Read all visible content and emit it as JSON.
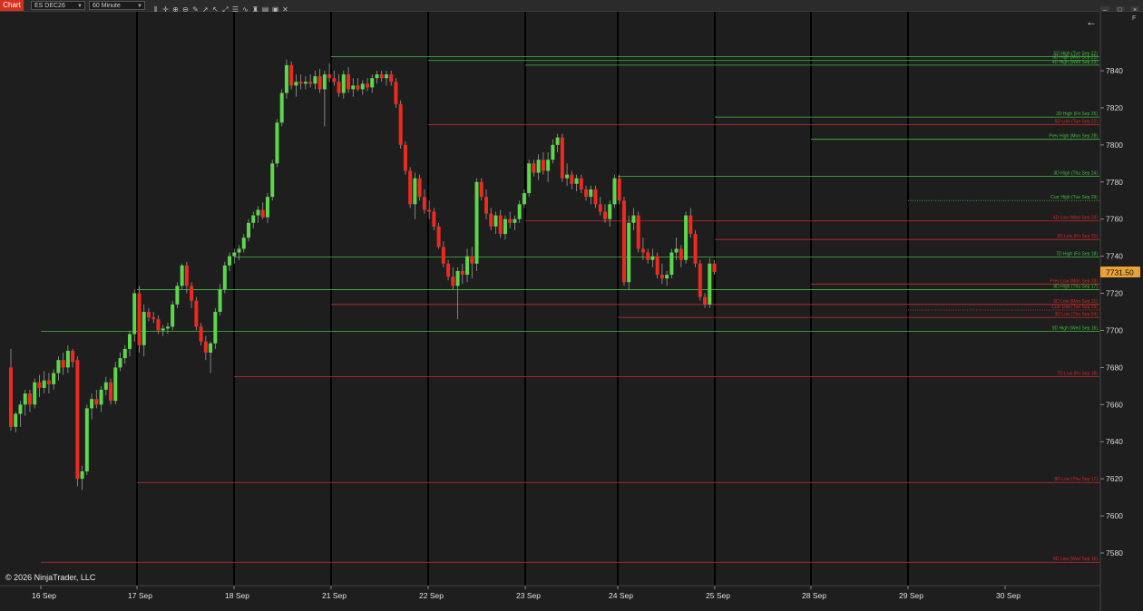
{
  "toolbar": {
    "tab_label": "Chart",
    "instrument": "ES DEC26",
    "interval": "60 Minute",
    "icons": [
      "bars-icon",
      "crosshair-icon",
      "zoom-in-icon",
      "zoom-out-icon",
      "pencil-icon",
      "arrow-icon",
      "pointer-icon",
      "expand-icon",
      "properties-icon",
      "indicator-icon",
      "strategy-icon",
      "template-icon",
      "screenshot-icon",
      "close-icon"
    ],
    "window_buttons": [
      "–",
      "□",
      "×"
    ]
  },
  "copyright": "© 2026 NinjaTrader, LLC",
  "back_arrow": "←",
  "panel_label": "F",
  "chart_data": {
    "type": "candlestick",
    "instrument": "ES DEC26",
    "interval": "60 Minute",
    "ylim": [
      7565,
      7856
    ],
    "grid": false,
    "colors": {
      "up": "#5ad84a",
      "down": "#ee2a1f",
      "support": "#3fbf3f",
      "resistance": "#d02a2a",
      "background": "#1e1e1e",
      "price_tag": "#e8a23a"
    },
    "y_ticks": [
      7840,
      7820,
      7800,
      7780,
      7760,
      7740,
      7720,
      7700,
      7680,
      7660,
      7640,
      7620,
      7600,
      7580
    ],
    "x_labels": [
      "16 Sep",
      "17 Sep",
      "18 Sep",
      "21 Sep",
      "22 Sep",
      "23 Sep",
      "24 Sep",
      "25 Sep",
      "28 Sep",
      "29 Sep",
      "30 Sep"
    ],
    "session_starts": [
      "17 Sep",
      "18 Sep",
      "21 Sep",
      "22 Sep",
      "23 Sep",
      "24 Sep",
      "25 Sep",
      "28 Sep",
      "29 Sep"
    ],
    "last_price": "7731.50",
    "levels": [
      {
        "label": "5D High (Tue Sep 22)",
        "price": 7847.5,
        "from": "21 Sep",
        "kind": "high"
      },
      {
        "label": "6D High (Mon Sep 21)",
        "price": 7845.5,
        "from": "22 Sep",
        "kind": "high"
      },
      {
        "label": "4D High (Wed Sep 23)",
        "price": 7843,
        "from": "23 Sep",
        "kind": "high"
      },
      {
        "label": "2D High (Fri Sep 25)",
        "price": 7815,
        "from": "25 Sep",
        "kind": "high"
      },
      {
        "label": "5D Low (Tue Sep 22)",
        "price": 7811,
        "from": "22 Sep",
        "kind": "low"
      },
      {
        "label": "Prev High (Mon Sep 28)",
        "price": 7803,
        "from": "28 Sep",
        "kind": "high"
      },
      {
        "label": "3D High (Thu Sep 24)",
        "price": 7783,
        "from": "24 Sep",
        "kind": "high"
      },
      {
        "label": "Curr High (Tue Sep 29)",
        "price": 7770,
        "from": "29 Sep",
        "kind": "high",
        "dotted": true
      },
      {
        "label": "4D Low (Wed Sep 23)",
        "price": 7759,
        "from": "23 Sep",
        "kind": "low"
      },
      {
        "label": "2D Low (Fri Sep 25)",
        "price": 7749,
        "from": "25 Sep",
        "kind": "low"
      },
      {
        "label": "7D High (Fri Sep 18)",
        "price": 7739.5,
        "from": "18 Sep",
        "kind": "high"
      },
      {
        "label": "Prev Low (Mon Sep 28)",
        "price": 7725,
        "from": "28 Sep",
        "kind": "low"
      },
      {
        "label": "8D High (Thu Sep 17)",
        "price": 7722,
        "from": "17 Sep",
        "kind": "high"
      },
      {
        "label": "6D Low (Mon Sep 21)",
        "price": 7714,
        "from": "21 Sep",
        "kind": "low"
      },
      {
        "label": "Curr Low (Tue Sep 29)",
        "price": 7711,
        "from": "29 Sep",
        "kind": "low",
        "dotted": true
      },
      {
        "label": "3D Low (Thu Sep 24)",
        "price": 7707,
        "from": "24 Sep",
        "kind": "low"
      },
      {
        "label": "9D High (Wed Sep 16)",
        "price": 7699.5,
        "from": "16 Sep",
        "kind": "high"
      },
      {
        "label": "7D Low (Fri Sep 18)",
        "price": 7675,
        "from": "18 Sep",
        "kind": "low"
      },
      {
        "label": "8D Low (Thu Sep 17)",
        "price": 7618,
        "from": "17 Sep",
        "kind": "low"
      },
      {
        "label": "9D Low (Wed Sep 16)",
        "price": 7575,
        "from": "16 Sep",
        "kind": "low"
      }
    ],
    "candles": [
      {
        "o": 7680,
        "h": 7690,
        "l": 7646,
        "c": 7648
      },
      {
        "o": 7648,
        "h": 7656,
        "l": 7645,
        "c": 7655
      },
      {
        "o": 7655,
        "h": 7662,
        "l": 7648,
        "c": 7660
      },
      {
        "o": 7660,
        "h": 7668,
        "l": 7654,
        "c": 7666
      },
      {
        "o": 7666,
        "h": 7668,
        "l": 7656,
        "c": 7660
      },
      {
        "o": 7660,
        "h": 7674,
        "l": 7658,
        "c": 7672
      },
      {
        "o": 7672,
        "h": 7676,
        "l": 7664,
        "c": 7669
      },
      {
        "o": 7669,
        "h": 7678,
        "l": 7666,
        "c": 7673
      },
      {
        "o": 7673,
        "h": 7677,
        "l": 7666,
        "c": 7671
      },
      {
        "o": 7671,
        "h": 7679,
        "l": 7668,
        "c": 7677
      },
      {
        "o": 7677,
        "h": 7686,
        "l": 7673,
        "c": 7684
      },
      {
        "o": 7684,
        "h": 7688,
        "l": 7676,
        "c": 7680
      },
      {
        "o": 7680,
        "h": 7692,
        "l": 7677,
        "c": 7689
      },
      {
        "o": 7689,
        "h": 7690,
        "l": 7680,
        "c": 7683
      },
      {
        "o": 7684,
        "h": 7686,
        "l": 7616,
        "c": 7620
      },
      {
        "o": 7620,
        "h": 7627,
        "l": 7614,
        "c": 7624
      },
      {
        "o": 7624,
        "h": 7660,
        "l": 7622,
        "c": 7658
      },
      {
        "o": 7658,
        "h": 7666,
        "l": 7652,
        "c": 7663
      },
      {
        "o": 7663,
        "h": 7668,
        "l": 7658,
        "c": 7660
      },
      {
        "o": 7660,
        "h": 7670,
        "l": 7656,
        "c": 7668
      },
      {
        "o": 7668,
        "h": 7675,
        "l": 7665,
        "c": 7672
      },
      {
        "o": 7672,
        "h": 7674,
        "l": 7660,
        "c": 7662
      },
      {
        "o": 7662,
        "h": 7683,
        "l": 7660,
        "c": 7680
      },
      {
        "o": 7680,
        "h": 7688,
        "l": 7678,
        "c": 7685
      },
      {
        "o": 7685,
        "h": 7692,
        "l": 7682,
        "c": 7690
      },
      {
        "o": 7690,
        "h": 7700,
        "l": 7686,
        "c": 7698
      },
      {
        "o": 7698,
        "h": 7722,
        "l": 7694,
        "c": 7720
      },
      {
        "o": 7720,
        "h": 7724,
        "l": 7688,
        "c": 7692
      },
      {
        "o": 7692,
        "h": 7714,
        "l": 7686,
        "c": 7710
      },
      {
        "o": 7710,
        "h": 7712,
        "l": 7705,
        "c": 7707
      },
      {
        "o": 7707,
        "h": 7710,
        "l": 7704,
        "c": 7706
      },
      {
        "o": 7706,
        "h": 7708,
        "l": 7698,
        "c": 7700
      },
      {
        "o": 7700,
        "h": 7703,
        "l": 7697,
        "c": 7701
      },
      {
        "o": 7701,
        "h": 7704,
        "l": 7698,
        "c": 7702
      },
      {
        "o": 7702,
        "h": 7716,
        "l": 7700,
        "c": 7714
      },
      {
        "o": 7714,
        "h": 7726,
        "l": 7712,
        "c": 7724
      },
      {
        "o": 7724,
        "h": 7736,
        "l": 7722,
        "c": 7735
      },
      {
        "o": 7735,
        "h": 7737,
        "l": 7720,
        "c": 7724
      },
      {
        "o": 7724,
        "h": 7726,
        "l": 7712,
        "c": 7716
      },
      {
        "o": 7716,
        "h": 7718,
        "l": 7700,
        "c": 7702
      },
      {
        "o": 7702,
        "h": 7704,
        "l": 7692,
        "c": 7694
      },
      {
        "o": 7694,
        "h": 7697,
        "l": 7684,
        "c": 7688
      },
      {
        "o": 7688,
        "h": 7694,
        "l": 7677,
        "c": 7693
      },
      {
        "o": 7693,
        "h": 7712,
        "l": 7690,
        "c": 7710
      },
      {
        "o": 7710,
        "h": 7725,
        "l": 7708,
        "c": 7722
      },
      {
        "o": 7722,
        "h": 7737,
        "l": 7720,
        "c": 7735
      },
      {
        "o": 7735,
        "h": 7742,
        "l": 7732,
        "c": 7740
      },
      {
        "o": 7740,
        "h": 7744,
        "l": 7736,
        "c": 7742
      },
      {
        "o": 7742,
        "h": 7746,
        "l": 7738,
        "c": 7744
      },
      {
        "o": 7744,
        "h": 7752,
        "l": 7742,
        "c": 7750
      },
      {
        "o": 7750,
        "h": 7760,
        "l": 7748,
        "c": 7758
      },
      {
        "o": 7758,
        "h": 7764,
        "l": 7755,
        "c": 7762
      },
      {
        "o": 7762,
        "h": 7767,
        "l": 7758,
        "c": 7765
      },
      {
        "o": 7765,
        "h": 7769,
        "l": 7760,
        "c": 7761
      },
      {
        "o": 7761,
        "h": 7774,
        "l": 7758,
        "c": 7772
      },
      {
        "o": 7772,
        "h": 7792,
        "l": 7770,
        "c": 7790
      },
      {
        "o": 7790,
        "h": 7814,
        "l": 7788,
        "c": 7812
      },
      {
        "o": 7812,
        "h": 7830,
        "l": 7810,
        "c": 7828
      },
      {
        "o": 7828,
        "h": 7846,
        "l": 7825,
        "c": 7843
      },
      {
        "o": 7843,
        "h": 7845,
        "l": 7830,
        "c": 7832
      },
      {
        "o": 7832,
        "h": 7838,
        "l": 7826,
        "c": 7834
      },
      {
        "o": 7834,
        "h": 7838,
        "l": 7830,
        "c": 7833
      },
      {
        "o": 7833,
        "h": 7837,
        "l": 7830,
        "c": 7834
      },
      {
        "o": 7834,
        "h": 7838,
        "l": 7831,
        "c": 7833
      },
      {
        "o": 7833,
        "h": 7840,
        "l": 7830,
        "c": 7837
      },
      {
        "o": 7837,
        "h": 7841,
        "l": 7828,
        "c": 7830
      },
      {
        "o": 7830,
        "h": 7840,
        "l": 7810,
        "c": 7838
      },
      {
        "o": 7838,
        "h": 7844,
        "l": 7834,
        "c": 7836
      },
      {
        "o": 7836,
        "h": 7840,
        "l": 7832,
        "c": 7834
      },
      {
        "o": 7834,
        "h": 7838,
        "l": 7826,
        "c": 7828
      },
      {
        "o": 7828,
        "h": 7840,
        "l": 7825,
        "c": 7838
      },
      {
        "o": 7838,
        "h": 7842,
        "l": 7828,
        "c": 7830
      },
      {
        "o": 7830,
        "h": 7836,
        "l": 7826,
        "c": 7832
      },
      {
        "o": 7832,
        "h": 7836,
        "l": 7829,
        "c": 7830
      },
      {
        "o": 7830,
        "h": 7835,
        "l": 7827,
        "c": 7833
      },
      {
        "o": 7833,
        "h": 7836,
        "l": 7829,
        "c": 7831
      },
      {
        "o": 7831,
        "h": 7838,
        "l": 7828,
        "c": 7836
      },
      {
        "o": 7836,
        "h": 7840,
        "l": 7833,
        "c": 7838
      },
      {
        "o": 7838,
        "h": 7840,
        "l": 7834,
        "c": 7836
      },
      {
        "o": 7836,
        "h": 7840,
        "l": 7832,
        "c": 7838
      },
      {
        "o": 7838,
        "h": 7840,
        "l": 7832,
        "c": 7834
      },
      {
        "o": 7834,
        "h": 7836,
        "l": 7820,
        "c": 7822
      },
      {
        "o": 7822,
        "h": 7824,
        "l": 7798,
        "c": 7800
      },
      {
        "o": 7800,
        "h": 7802,
        "l": 7784,
        "c": 7786
      },
      {
        "o": 7786,
        "h": 7788,
        "l": 7766,
        "c": 7768
      },
      {
        "o": 7768,
        "h": 7785,
        "l": 7760,
        "c": 7782
      },
      {
        "o": 7782,
        "h": 7784,
        "l": 7770,
        "c": 7772
      },
      {
        "o": 7772,
        "h": 7776,
        "l": 7763,
        "c": 7765
      },
      {
        "o": 7765,
        "h": 7770,
        "l": 7760,
        "c": 7764
      },
      {
        "o": 7764,
        "h": 7766,
        "l": 7754,
        "c": 7756
      },
      {
        "o": 7756,
        "h": 7758,
        "l": 7744,
        "c": 7745
      },
      {
        "o": 7745,
        "h": 7748,
        "l": 7734,
        "c": 7736
      },
      {
        "o": 7736,
        "h": 7738,
        "l": 7727,
        "c": 7729
      },
      {
        "o": 7729,
        "h": 7734,
        "l": 7722,
        "c": 7724
      },
      {
        "o": 7724,
        "h": 7734,
        "l": 7706,
        "c": 7732
      },
      {
        "o": 7732,
        "h": 7736,
        "l": 7725,
        "c": 7730
      },
      {
        "o": 7730,
        "h": 7744,
        "l": 7726,
        "c": 7740
      },
      {
        "o": 7740,
        "h": 7745,
        "l": 7728,
        "c": 7736
      },
      {
        "o": 7736,
        "h": 7782,
        "l": 7732,
        "c": 7780
      },
      {
        "o": 7780,
        "h": 7782,
        "l": 7770,
        "c": 7772
      },
      {
        "o": 7772,
        "h": 7776,
        "l": 7760,
        "c": 7763
      },
      {
        "o": 7763,
        "h": 7766,
        "l": 7754,
        "c": 7756
      },
      {
        "o": 7756,
        "h": 7764,
        "l": 7752,
        "c": 7762
      },
      {
        "o": 7762,
        "h": 7765,
        "l": 7750,
        "c": 7752
      },
      {
        "o": 7752,
        "h": 7762,
        "l": 7749,
        "c": 7760
      },
      {
        "o": 7760,
        "h": 7764,
        "l": 7755,
        "c": 7758
      },
      {
        "o": 7758,
        "h": 7762,
        "l": 7754,
        "c": 7760
      },
      {
        "o": 7760,
        "h": 7770,
        "l": 7758,
        "c": 7768
      },
      {
        "o": 7768,
        "h": 7776,
        "l": 7766,
        "c": 7774
      },
      {
        "o": 7774,
        "h": 7792,
        "l": 7772,
        "c": 7790
      },
      {
        "o": 7790,
        "h": 7792,
        "l": 7783,
        "c": 7785
      },
      {
        "o": 7785,
        "h": 7795,
        "l": 7781,
        "c": 7792
      },
      {
        "o": 7792,
        "h": 7796,
        "l": 7784,
        "c": 7786
      },
      {
        "o": 7786,
        "h": 7796,
        "l": 7780,
        "c": 7792
      },
      {
        "o": 7792,
        "h": 7803,
        "l": 7790,
        "c": 7800
      },
      {
        "o": 7800,
        "h": 7806,
        "l": 7796,
        "c": 7804
      },
      {
        "o": 7804,
        "h": 7806,
        "l": 7780,
        "c": 7782
      },
      {
        "o": 7782,
        "h": 7790,
        "l": 7778,
        "c": 7784
      },
      {
        "o": 7784,
        "h": 7786,
        "l": 7776,
        "c": 7779
      },
      {
        "o": 7779,
        "h": 7784,
        "l": 7775,
        "c": 7782
      },
      {
        "o": 7782,
        "h": 7784,
        "l": 7774,
        "c": 7776
      },
      {
        "o": 7776,
        "h": 7778,
        "l": 7770,
        "c": 7772
      },
      {
        "o": 7772,
        "h": 7778,
        "l": 7768,
        "c": 7776
      },
      {
        "o": 7776,
        "h": 7778,
        "l": 7766,
        "c": 7768
      },
      {
        "o": 7768,
        "h": 7772,
        "l": 7762,
        "c": 7764
      },
      {
        "o": 7764,
        "h": 7768,
        "l": 7758,
        "c": 7760
      },
      {
        "o": 7760,
        "h": 7770,
        "l": 7756,
        "c": 7768
      },
      {
        "o": 7768,
        "h": 7784,
        "l": 7766,
        "c": 7782
      },
      {
        "o": 7782,
        "h": 7784,
        "l": 7768,
        "c": 7770
      },
      {
        "o": 7770,
        "h": 7772,
        "l": 7724,
        "c": 7726
      },
      {
        "o": 7726,
        "h": 7762,
        "l": 7722,
        "c": 7758
      },
      {
        "o": 7758,
        "h": 7766,
        "l": 7754,
        "c": 7762
      },
      {
        "o": 7762,
        "h": 7764,
        "l": 7742,
        "c": 7744
      },
      {
        "o": 7744,
        "h": 7750,
        "l": 7738,
        "c": 7742
      },
      {
        "o": 7742,
        "h": 7744,
        "l": 7736,
        "c": 7738
      },
      {
        "o": 7738,
        "h": 7744,
        "l": 7734,
        "c": 7740
      },
      {
        "o": 7740,
        "h": 7742,
        "l": 7728,
        "c": 7730
      },
      {
        "o": 7730,
        "h": 7736,
        "l": 7725,
        "c": 7728
      },
      {
        "o": 7728,
        "h": 7732,
        "l": 7724,
        "c": 7730
      },
      {
        "o": 7730,
        "h": 7744,
        "l": 7728,
        "c": 7742
      },
      {
        "o": 7742,
        "h": 7750,
        "l": 7738,
        "c": 7744
      },
      {
        "o": 7744,
        "h": 7746,
        "l": 7734,
        "c": 7738
      },
      {
        "o": 7738,
        "h": 7764,
        "l": 7736,
        "c": 7762
      },
      {
        "o": 7762,
        "h": 7766,
        "l": 7750,
        "c": 7752
      },
      {
        "o": 7752,
        "h": 7754,
        "l": 7734,
        "c": 7736
      },
      {
        "o": 7736,
        "h": 7738,
        "l": 7716,
        "c": 7718
      },
      {
        "o": 7718,
        "h": 7720,
        "l": 7712,
        "c": 7714
      },
      {
        "o": 7714,
        "h": 7739,
        "l": 7712,
        "c": 7736
      },
      {
        "o": 7736,
        "h": 7738,
        "l": 7730,
        "c": 7731.5
      }
    ]
  }
}
